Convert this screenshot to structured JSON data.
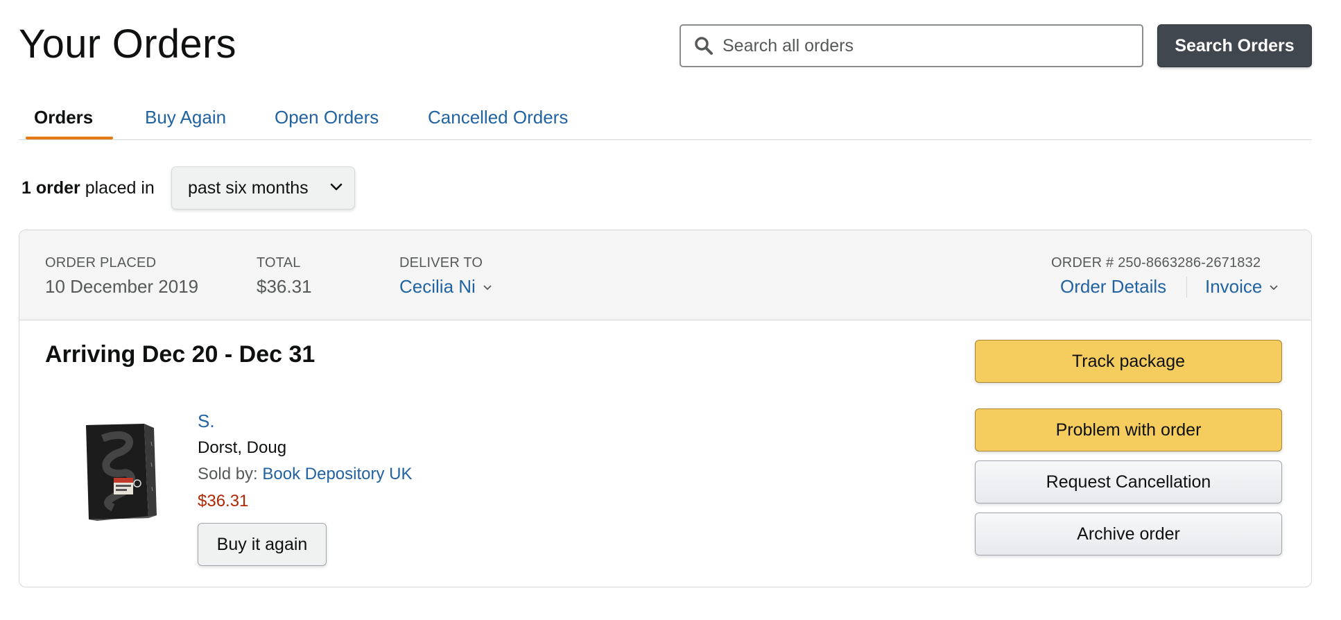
{
  "page": {
    "title": "Your Orders"
  },
  "search": {
    "placeholder": "Search all orders",
    "button_label": "Search Orders"
  },
  "tabs": [
    {
      "label": "Orders",
      "active": true
    },
    {
      "label": "Buy Again",
      "active": false
    },
    {
      "label": "Open Orders",
      "active": false
    },
    {
      "label": "Cancelled Orders",
      "active": false
    }
  ],
  "filter": {
    "count_text": "1 order",
    "suffix": " placed in",
    "selected_range": "past six months"
  },
  "order": {
    "placed_label": "ORDER PLACED",
    "placed_value": "10 December 2019",
    "total_label": "TOTAL",
    "total_value": "$36.31",
    "deliver_label": "DELIVER TO",
    "deliver_value": "Cecilia Ni",
    "order_number": "ORDER # 250-8663286-2671832",
    "details_link": "Order Details",
    "invoice_link": "Invoice",
    "arriving": "Arriving Dec 20 - Dec 31",
    "item": {
      "title": "S.",
      "author": "Dorst, Doug",
      "sold_by_label": "Sold by: ",
      "seller": "Book Depository UK",
      "price": "$36.31",
      "buy_again_label": "Buy it again"
    },
    "actions": {
      "track": "Track package",
      "problem": "Problem with order",
      "cancel": "Request Cancellation",
      "archive": "Archive order"
    }
  },
  "colors": {
    "link": "#2162a1",
    "price": "#b12704",
    "accent": "#e47911",
    "yellow_button": "#f5cc5e"
  },
  "icons": [
    "search-icon",
    "chevron-down-icon",
    "book-cover-image"
  ]
}
